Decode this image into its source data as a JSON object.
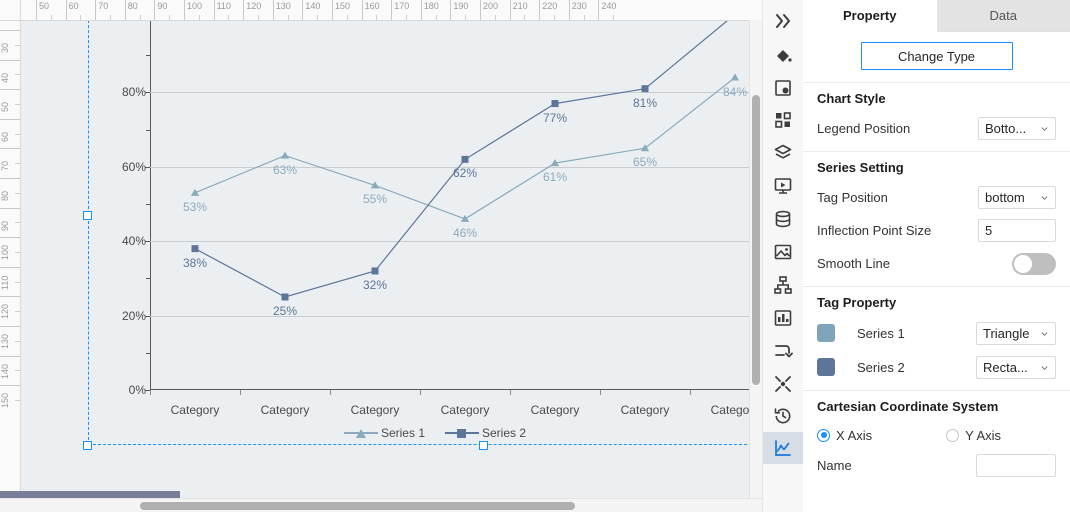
{
  "chart_data": {
    "type": "line",
    "title": "",
    "xlabel": "",
    "ylabel": "",
    "categories": [
      "Category",
      "Category",
      "Category",
      "Category",
      "Category",
      "Category",
      "Category"
    ],
    "ylim": [
      0,
      100
    ],
    "ytick_labels": [
      "0%",
      "20%",
      "40%",
      "60%",
      "80%"
    ],
    "ytick_values": [
      0,
      20,
      40,
      60,
      80
    ],
    "grid": true,
    "legend_position": "bottom",
    "series": [
      {
        "name": "Series 1",
        "marker": "triangle",
        "color": "#8aabbe",
        "values": [
          53,
          63,
          55,
          46,
          61,
          65,
          84
        ],
        "labels": [
          "53%",
          "63%",
          "55%",
          "46%",
          "61%",
          "65%",
          "84%"
        ]
      },
      {
        "name": "Series 2",
        "marker": "rectangle",
        "color": "#5c7599",
        "values": [
          38,
          25,
          32,
          62,
          77,
          81,
          101
        ],
        "labels": [
          "38%",
          "25%",
          "32%",
          "62%",
          "77%",
          "81%",
          ""
        ]
      }
    ]
  },
  "ruler": {
    "horizontal": [
      "50",
      "60",
      "70",
      "80",
      "90",
      "100",
      "110",
      "120",
      "130",
      "140",
      "150",
      "160",
      "170",
      "180",
      "190",
      "200",
      "210",
      "220",
      "230",
      "240"
    ],
    "vertical": [
      "30",
      "40",
      "50",
      "60",
      "70",
      "80",
      "90",
      "100",
      "110",
      "120",
      "130",
      "140",
      "150"
    ]
  },
  "rail": {
    "items": [
      {
        "name": "collapse-panel-icon",
        "label": "Collapse"
      },
      {
        "name": "fill-color-icon",
        "label": "Fill"
      },
      {
        "name": "component-settings-icon",
        "label": "Component"
      },
      {
        "name": "widgets-icon",
        "label": "Widgets"
      },
      {
        "name": "layers-icon",
        "label": "Layers"
      },
      {
        "name": "presentation-icon",
        "label": "Presentation"
      },
      {
        "name": "database-icon",
        "label": "Data Source"
      },
      {
        "name": "image-icon",
        "label": "Image"
      },
      {
        "name": "hierarchy-icon",
        "label": "Hierarchy"
      },
      {
        "name": "report-icon",
        "label": "Report"
      },
      {
        "name": "flow-icon",
        "label": "Flow"
      },
      {
        "name": "scatter-icon",
        "label": "Scatter"
      },
      {
        "name": "history-icon",
        "label": "History"
      },
      {
        "name": "chart-icon",
        "label": "Chart"
      }
    ],
    "active_index": 13
  },
  "panel": {
    "tabs": [
      {
        "label": "Property",
        "active": true
      },
      {
        "label": "Data",
        "active": false
      }
    ],
    "change_type_label": "Change Type",
    "chart_style": {
      "title": "Chart Style",
      "legend_position_label": "Legend Position",
      "legend_position_value": "Botto..."
    },
    "series_setting": {
      "title": "Series Setting",
      "tag_position_label": "Tag Position",
      "tag_position_value": "bottom",
      "inflection_point_size_label": "Inflection Point Size",
      "inflection_point_size_value": "5",
      "smooth_line_label": "Smooth Line",
      "smooth_line_on": false
    },
    "tag_property": {
      "title": "Tag Property",
      "rows": [
        {
          "color": "#7ea5ba",
          "name": "Series 1",
          "shape": "Triangle"
        },
        {
          "color": "#5c7599",
          "name": "Series 2",
          "shape": "Recta..."
        }
      ]
    },
    "cartesian": {
      "title": "Cartesian Coordinate System",
      "x_axis_label": "X Axis",
      "y_axis_label": "Y Axis",
      "selected_axis": "X Axis",
      "name_label": "Name",
      "name_value": ""
    }
  }
}
